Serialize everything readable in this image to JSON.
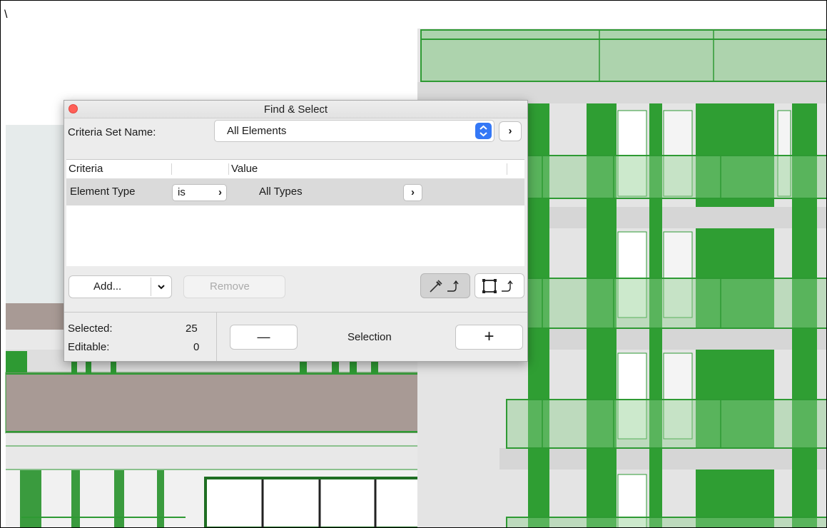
{
  "corner_mark": "\\",
  "dialog": {
    "title": "Find & Select",
    "criteria_set_label": "Criteria Set Name:",
    "criteria_set_value": "All Elements",
    "stepper_glyph": "⌃⌄",
    "arrow_glyph": "›",
    "table": {
      "headers": [
        "Criteria",
        "Value"
      ],
      "rows": [
        {
          "criterion": "Element Type",
          "operator": "is",
          "value": "All Types"
        }
      ]
    },
    "add_label": "Add...",
    "add_dropdown_glyph": "⌄",
    "remove_label": "Remove",
    "selected_label": "Selected:",
    "selected_count": "25",
    "editable_label": "Editable:",
    "editable_count": "0",
    "minus_glyph": "—",
    "selection_label": "Selection",
    "plus_glyph": "+"
  },
  "colors": {
    "accent": "#3478f6",
    "close": "#ff5f57",
    "model_green": "#2f9e33",
    "model_grey": "#e6e6e6",
    "brick": "#a89a95"
  },
  "icons": [
    "close-icon",
    "stepper-icon",
    "chevron-right-icon",
    "chevron-down-icon",
    "eyedropper-transfer-icon",
    "marquee-transfer-icon"
  ]
}
